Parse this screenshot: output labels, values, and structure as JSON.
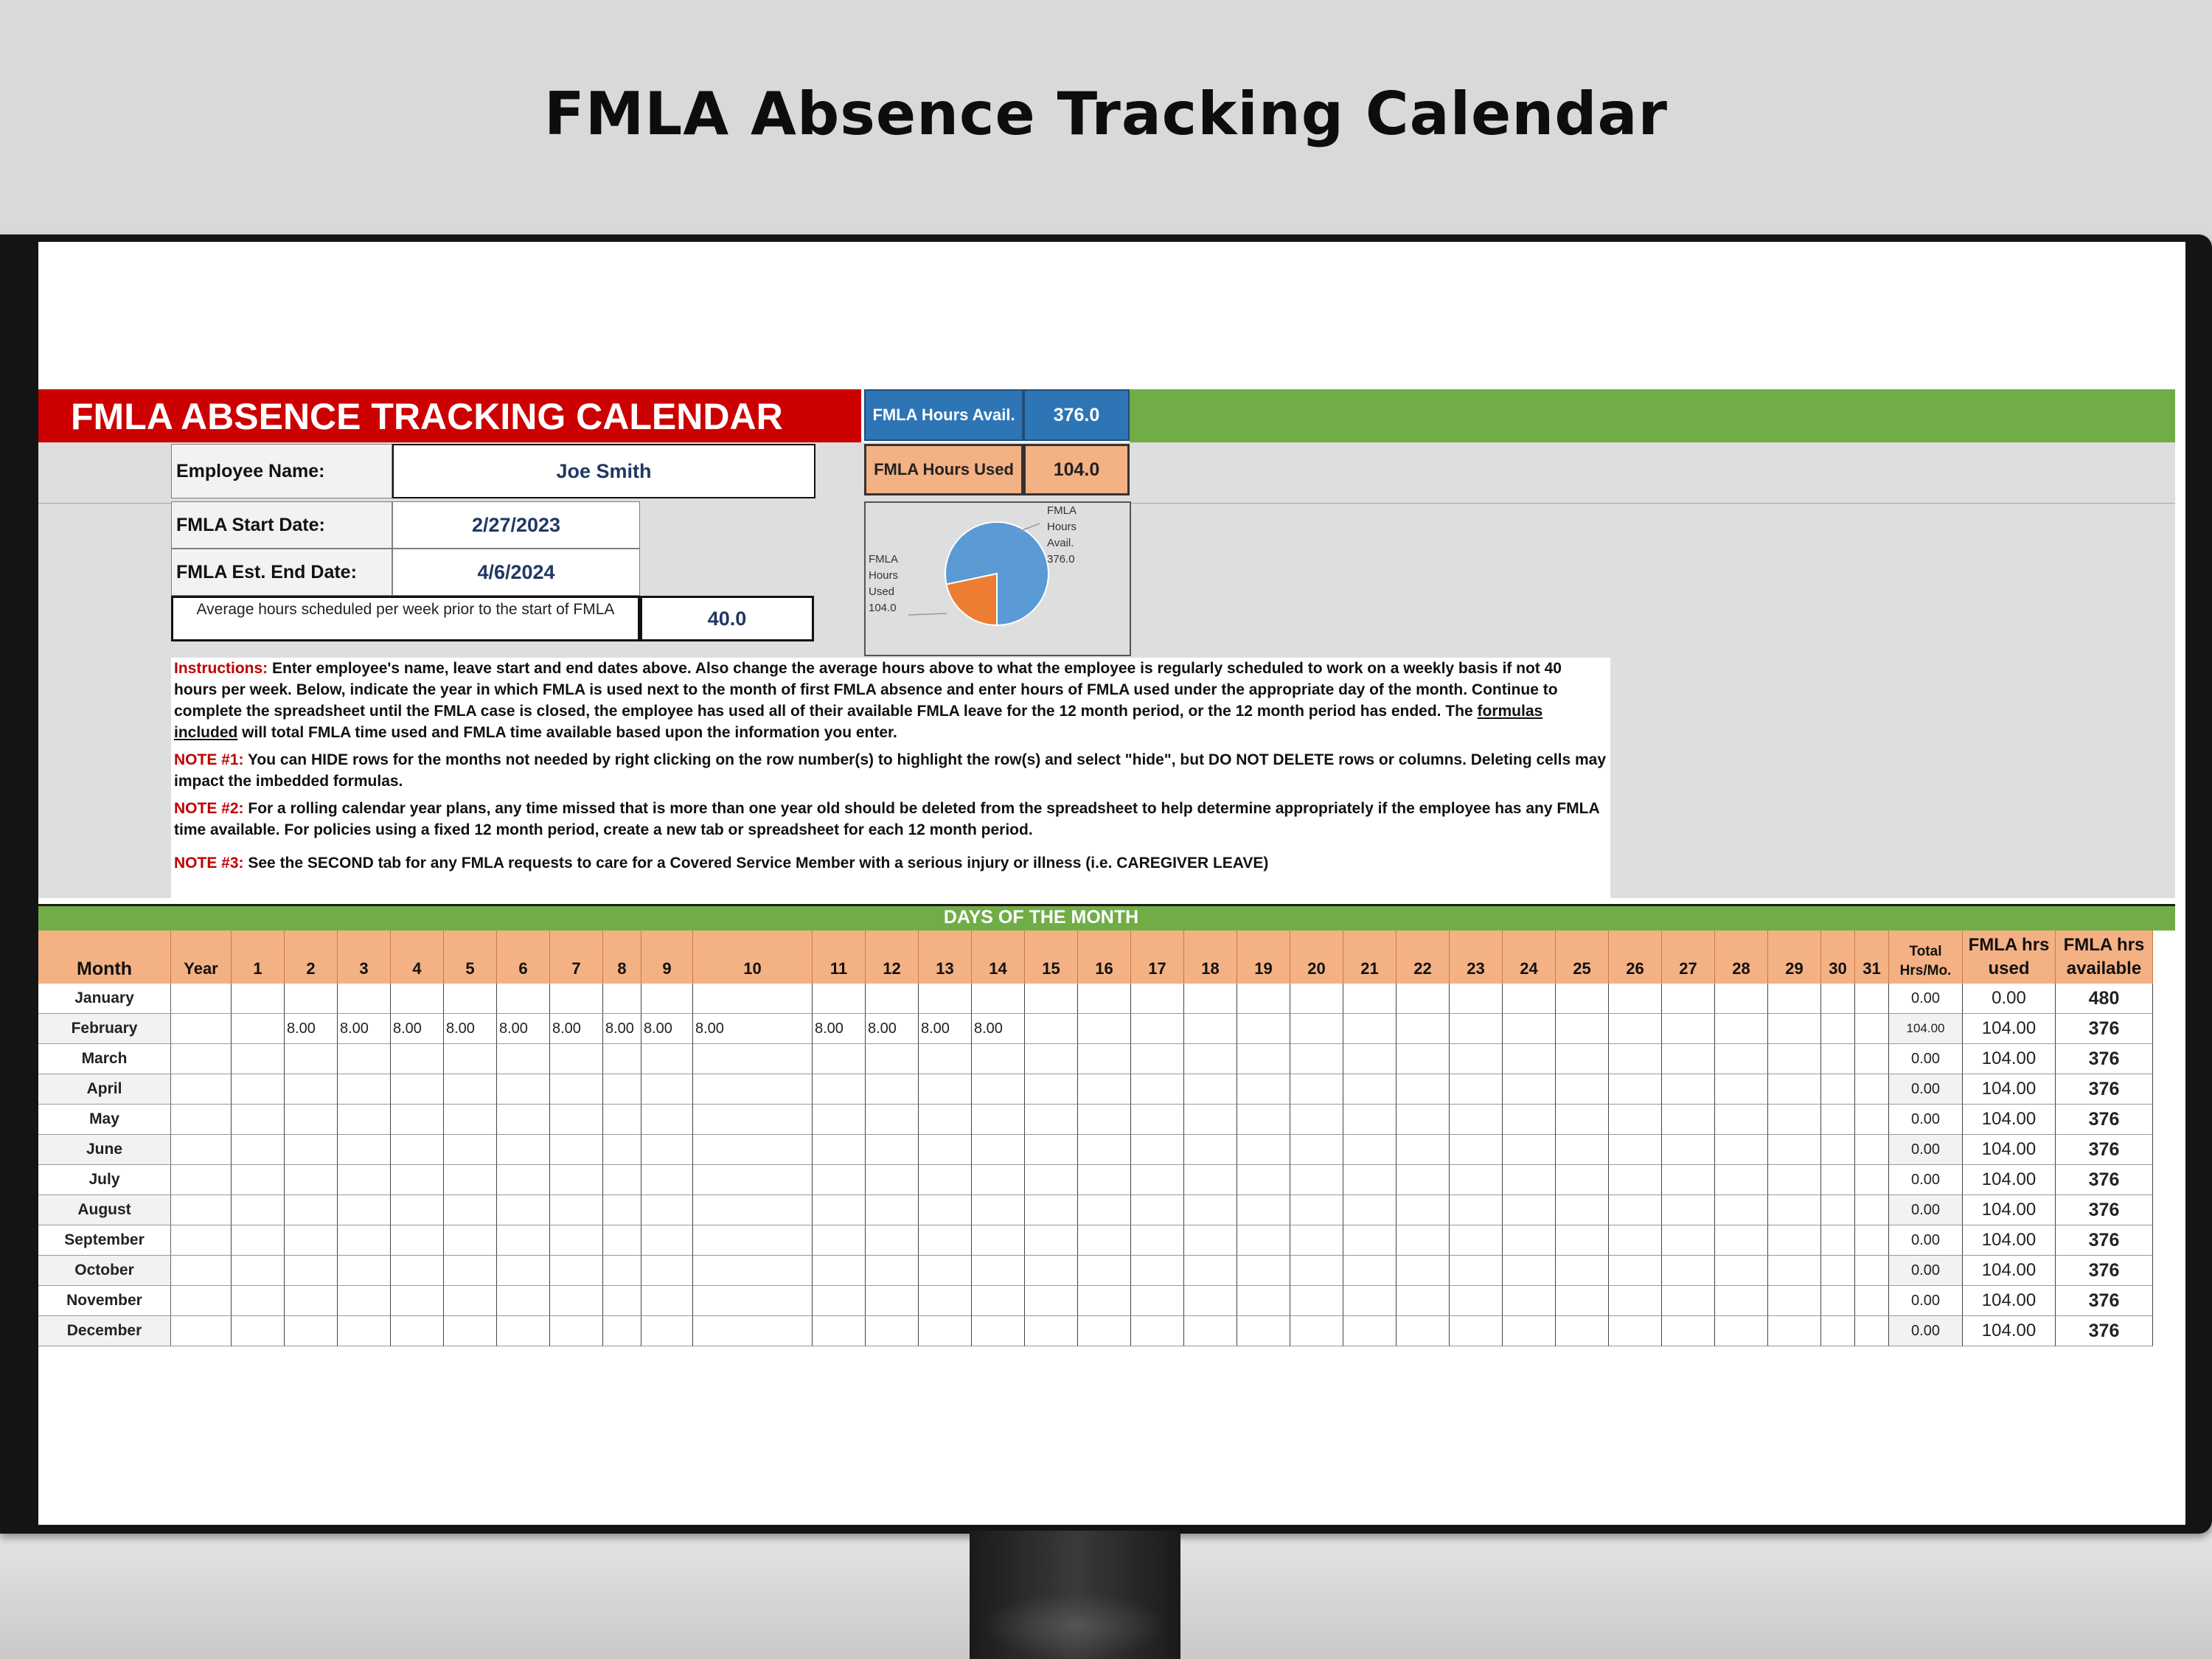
{
  "banner": {
    "title": "FMLA Absence Tracking Calendar"
  },
  "sheet": {
    "title": "FMLA ABSENCE TRACKING CALENDAR",
    "stats": {
      "avail_label": "FMLA Hours Avail.",
      "avail_value": "376.0",
      "used_label": "FMLA Hours Used",
      "used_value": "104.0"
    },
    "fields": {
      "employee_label": "Employee Name:",
      "employee_value": "Joe Smith",
      "start_label": "FMLA Start Date:",
      "start_value": "2/27/2023",
      "end_label": "FMLA Est. End Date:",
      "end_value": "4/6/2024",
      "avg_label": "Average hours scheduled per week prior to the start of FMLA",
      "avg_value": "40.0"
    },
    "pie": {
      "used_label_lines": [
        "FMLA",
        "Hours",
        "Used",
        "104.0"
      ],
      "avail_label_lines": [
        "FMLA",
        "Hours",
        "Avail.",
        "376.0"
      ],
      "used": 104.0,
      "avail": 376.0,
      "colors": {
        "used": "#ed7d31",
        "avail": "#5b9bd5"
      }
    },
    "instructions": {
      "p1_tag": "Instructions:",
      "p1_a": " Enter employee's name, leave start and end dates above.  Also change the average hours above to what the employee is regularly scheduled to work on a weekly basis if not 40 hours per week.  Below, indicate the year in which FMLA is used next to the month of first FMLA absence and enter hours of FMLA used under the appropriate day of the month. Continue to complete the spreadsheet until the FMLA case is closed, the employee has used all of their available FMLA leave for the 12 month period, or the 12 month period has ended.  The ",
      "p1_link": "formulas included",
      "p1_b": " will total FMLA time used and FMLA time available based upon the information you enter.",
      "n1_tag": "NOTE #1:",
      "n1": " You can HIDE rows for the months not needed by right clicking on the row number(s) to highlight the row(s) and select \"hide\", but DO NOT DELETE rows or columns.  Deleting cells may impact the imbedded formulas.",
      "n2_tag": "NOTE #2:",
      "n2": "  For a rolling calendar year plans, any time missed that is more than one year old should be deleted from the spreadsheet to help determine appropriately if the employee has any FMLA time available.  For policies using a fixed 12 month period, create a new tab or spreadsheet for each 12 month period.",
      "n3_tag": "NOTE #3:",
      "n3": " See the SECOND tab for any FMLA requests to care for a Covered Service Member with a serious injury or illness (i.e. CAREGIVER LEAVE)"
    },
    "days_header": "DAYS OF THE MONTH",
    "columns": {
      "month": "Month",
      "year": "Year",
      "days": [
        "1",
        "2",
        "3",
        "4",
        "5",
        "6",
        "7",
        "8",
        "9",
        "10",
        "11",
        "12",
        "13",
        "14",
        "15",
        "16",
        "17",
        "18",
        "19",
        "20",
        "21",
        "22",
        "23",
        "24",
        "25",
        "26",
        "27",
        "28",
        "29",
        "30",
        "31"
      ],
      "total": "Total Hrs/Mo.",
      "used": "FMLA hrs used",
      "avail": "FMLA hrs available"
    },
    "rows": [
      {
        "month": "January",
        "total": "0.00",
        "used": "0.00",
        "avail": "480",
        "days": {}
      },
      {
        "month": "February",
        "total": "104.00",
        "used": "104.00",
        "avail": "376",
        "days": {
          "2": "8.00",
          "3": "8.00",
          "4": "8.00",
          "5": "8.00",
          "6": "8.00",
          "7": "8.00",
          "8": "8.00",
          "9": "8.00",
          "10": "8.00",
          "11": "8.00",
          "12": "8.00",
          "13": "8.00",
          "14": "8.00"
        }
      },
      {
        "month": "March",
        "total": "0.00",
        "used": "104.00",
        "avail": "376",
        "days": {}
      },
      {
        "month": "April",
        "total": "0.00",
        "used": "104.00",
        "avail": "376",
        "days": {}
      },
      {
        "month": "May",
        "total": "0.00",
        "used": "104.00",
        "avail": "376",
        "days": {}
      },
      {
        "month": "June",
        "total": "0.00",
        "used": "104.00",
        "avail": "376",
        "days": {}
      },
      {
        "month": "July",
        "total": "0.00",
        "used": "104.00",
        "avail": "376",
        "days": {}
      },
      {
        "month": "August",
        "total": "0.00",
        "used": "104.00",
        "avail": "376",
        "days": {}
      },
      {
        "month": "September",
        "total": "0.00",
        "used": "104.00",
        "avail": "376",
        "days": {}
      },
      {
        "month": "October",
        "total": "0.00",
        "used": "104.00",
        "avail": "376",
        "days": {}
      },
      {
        "month": "November",
        "total": "0.00",
        "used": "104.00",
        "avail": "376",
        "days": {}
      },
      {
        "month": "December",
        "total": "0.00",
        "used": "104.00",
        "avail": "376",
        "days": {}
      }
    ]
  }
}
